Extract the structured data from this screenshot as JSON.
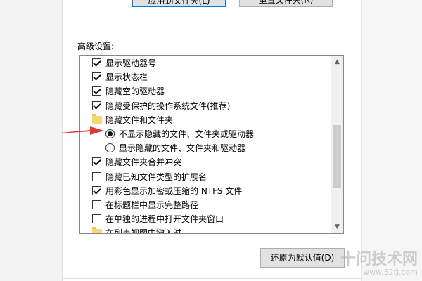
{
  "top_buttons": [
    "应用到文件夹(L)",
    "重置文件夹(R)"
  ],
  "advanced": {
    "label": "高级设置:",
    "items": [
      {
        "type": "checkbox",
        "checked": true,
        "label": "显示驱动器号"
      },
      {
        "type": "checkbox",
        "checked": true,
        "label": "显示状态栏"
      },
      {
        "type": "checkbox",
        "checked": true,
        "label": "隐藏空的驱动器"
      },
      {
        "type": "checkbox",
        "checked": true,
        "label": "隐藏受保护的操作系统文件(推荐)"
      },
      {
        "type": "folder",
        "label": "隐藏文件和文件夹"
      },
      {
        "type": "radio",
        "checked": true,
        "label": "不显示隐藏的文件、文件夹或驱动器"
      },
      {
        "type": "radio",
        "checked": false,
        "label": "显示隐藏的文件、文件夹和驱动器"
      },
      {
        "type": "checkbox",
        "checked": true,
        "label": "隐藏文件夹合并冲突"
      },
      {
        "type": "checkbox",
        "checked": false,
        "label": "隐藏已知文件类型的扩展名"
      },
      {
        "type": "checkbox",
        "checked": true,
        "label": "用彩色显示加密或压缩的 NTFS 文件"
      },
      {
        "type": "checkbox",
        "checked": false,
        "label": "在标题栏中显示完整路径"
      },
      {
        "type": "checkbox",
        "checked": false,
        "label": "在单独的进程中打开文件夹窗口"
      },
      {
        "type": "folder",
        "label": "在列表视图中键入时"
      }
    ]
  },
  "restore_button": "还原为默认值(D)",
  "watermark": {
    "main": "十问技术网",
    "url": "www.52tj.com"
  },
  "colors": {
    "annotation_arrow": "#e53935",
    "focus_border": "#0078d7"
  }
}
